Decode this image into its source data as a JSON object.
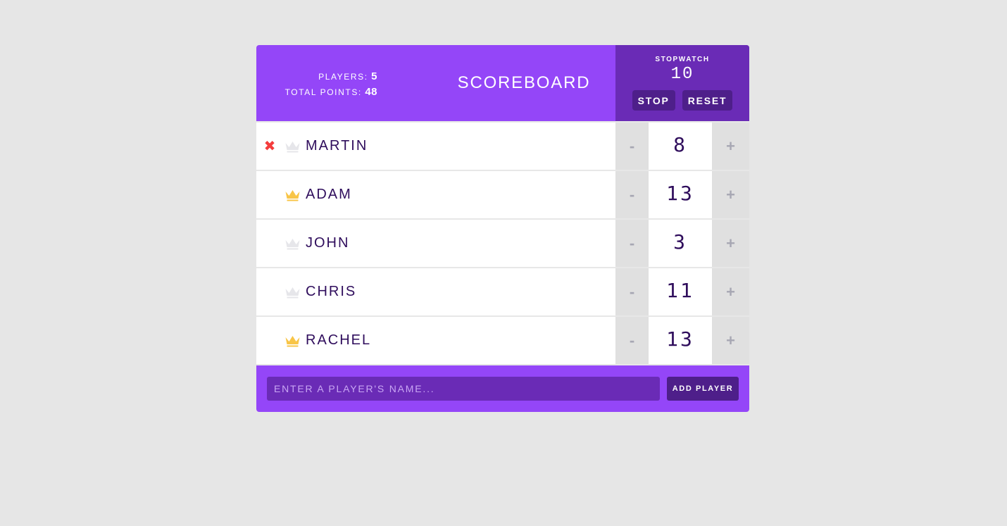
{
  "header": {
    "players_label": "PLAYERS:",
    "players_count": "5",
    "total_points_label": "TOTAL POINTS:",
    "total_points": "48",
    "title": "SCOREBOARD"
  },
  "stopwatch": {
    "label": "STOPWATCH",
    "time": "10",
    "stop_label": "STOP",
    "reset_label": "RESET"
  },
  "players": [
    {
      "name": "MARTIN",
      "score": "8",
      "leader": false,
      "removable": true
    },
    {
      "name": "ADAM",
      "score": "13",
      "leader": true,
      "removable": false
    },
    {
      "name": "JOHN",
      "score": "3",
      "leader": false,
      "removable": false
    },
    {
      "name": "CHRIS",
      "score": "11",
      "leader": false,
      "removable": false
    },
    {
      "name": "RACHEL",
      "score": "13",
      "leader": true,
      "removable": false
    }
  ],
  "controls": {
    "decrement_label": "-",
    "increment_label": "+",
    "remove_icon": "✖"
  },
  "footer": {
    "input_placeholder": "ENTER A PLAYER'S NAME...",
    "add_label": "ADD PLAYER"
  },
  "colors": {
    "accent": "#9446f8",
    "accent_dark": "#6a2bb6",
    "button_dark": "#4e1f8a",
    "crown_leader": "#f8c547",
    "crown_inactive": "#e6e6ea",
    "remove_red": "#f43c3c",
    "name_text": "#2f0d5c"
  }
}
